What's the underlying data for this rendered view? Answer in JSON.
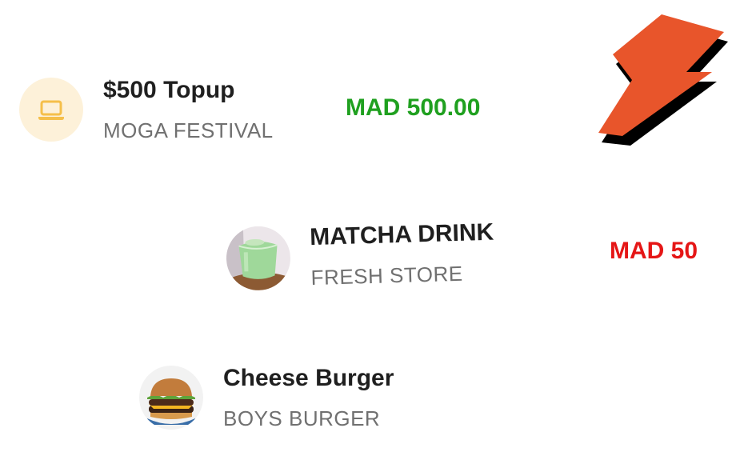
{
  "transactions": [
    {
      "title": "$500 Topup",
      "merchant": "MOGA FESTIVAL",
      "amount": "MAD 500.00",
      "icon": "laptop-icon",
      "amount_color": "#1fa01f"
    },
    {
      "title": "MATCHA DRINK",
      "merchant": "FRESH STORE",
      "amount": "MAD 50",
      "icon": "matcha-drink-image",
      "amount_color": "#e51616"
    },
    {
      "title": "Cheese Burger",
      "merchant": "BOYS BURGER",
      "icon": "cheese-burger-image"
    }
  ],
  "decoration": {
    "icon": "lightning-bolt-icon",
    "color": "#e8552b"
  },
  "colors": {
    "title": "#1f1f1f",
    "subtitle": "#707070",
    "topup_avatar_bg": "#fdf1d9",
    "laptop_icon": "#f5bf4a"
  }
}
